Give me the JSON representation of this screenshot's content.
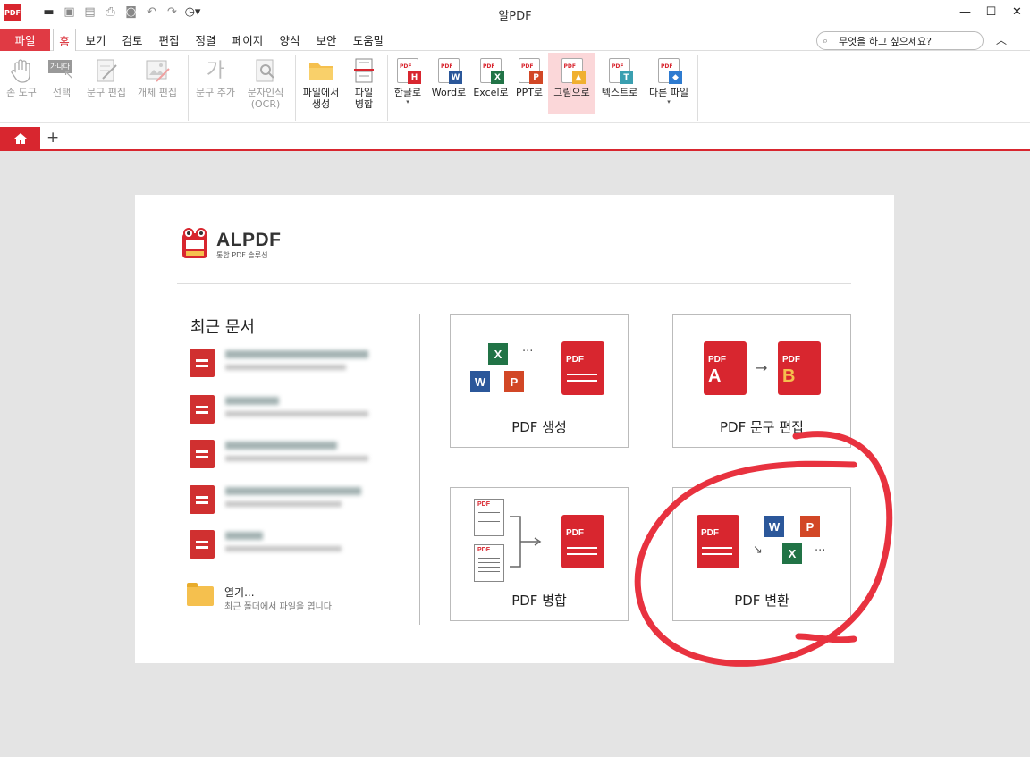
{
  "app": {
    "title": "알PDF",
    "logo_text": "PDF"
  },
  "quick_access": [
    "folder-open",
    "save",
    "save-all",
    "print",
    "print-preview",
    "undo",
    "redo",
    "history"
  ],
  "window_controls": {
    "minimize": "—",
    "maximize": "☐",
    "close": "✕"
  },
  "menu": {
    "file": "파일",
    "tabs": [
      "홈",
      "보기",
      "검토",
      "편집",
      "정렬",
      "페이지",
      "양식",
      "보안",
      "도움말"
    ],
    "search_placeholder": "무엇을 하고 싶으세요?"
  },
  "ribbon": {
    "hand_tool": "손 도구",
    "select": "선택",
    "select_icon_text": "가나다",
    "text_edit": "문구 편집",
    "object_edit": "개체 편집",
    "text_add": "문구 추가",
    "text_add_icon": "가",
    "ocr_line1": "문자인식",
    "ocr_line2": "(OCR)",
    "create_line1": "파일에서",
    "create_line2": "생성",
    "merge_line1": "파일",
    "merge_line2": "병합",
    "to_hangul": "한글로",
    "to_word": "Word로",
    "to_excel": "Excel로",
    "to_ppt": "PPT로",
    "to_image": "그림으로",
    "to_text": "텍스트로",
    "to_other": "다른 파일",
    "badges": {
      "hangul": "H",
      "word": "W",
      "excel": "X",
      "ppt": "P",
      "text": "T"
    },
    "pdf_tag": "PDF"
  },
  "start": {
    "brand_name": "ALPDF",
    "brand_sub": "통합 PDF 솔루션",
    "recent_title": "최근 문서",
    "open_label": "열기...",
    "open_desc": "최근 폴더에서 파일을 엽니다.",
    "cards": {
      "create": "PDF 생성",
      "text_edit": "PDF 문구 편집",
      "merge": "PDF 병합",
      "convert": "PDF 변환"
    },
    "pdf_tag": "PDF",
    "edit_a": "A",
    "edit_b": "B",
    "ellipsis": "···"
  },
  "colors": {
    "accent": "#d8262f",
    "menu_file_bg": "#e03a44",
    "active_ribbon_bg": "#fbd7d9",
    "annotation": "#e8323f",
    "word": "#2b579a",
    "excel": "#217346",
    "ppt": "#d24726",
    "hangul": "#d8262f",
    "text": "#3a9fb0"
  }
}
